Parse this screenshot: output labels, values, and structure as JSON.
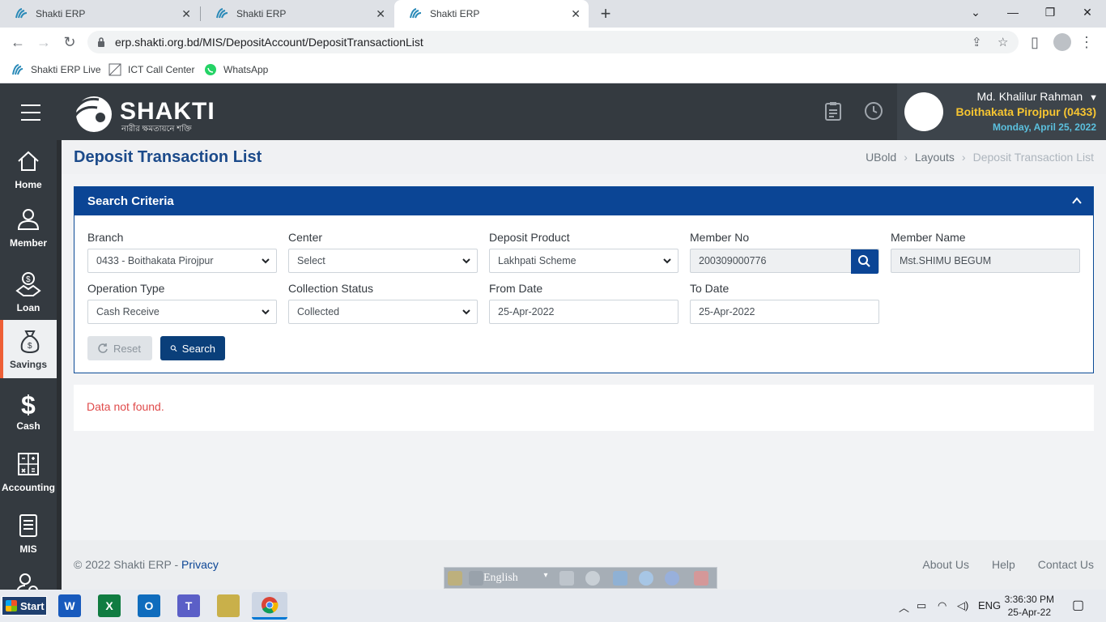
{
  "browser": {
    "tabs": [
      {
        "title": "Shakti ERP"
      },
      {
        "title": "Shakti ERP"
      },
      {
        "title": "Shakti ERP"
      }
    ],
    "url": "erp.shakti.org.bd/MIS/DepositAccount/DepositTransactionList",
    "bookmarks": [
      {
        "label": "Shakti ERP Live"
      },
      {
        "label": "ICT Call Center"
      },
      {
        "label": "WhatsApp"
      }
    ]
  },
  "header": {
    "logo_text": "SHAKTI",
    "logo_subtitle": "নারীর ক্ষমতায়নে শক্তি",
    "user_name": "Md. Khalilur Rahman",
    "branch": "Boithakata Pirojpur (0433)",
    "date": "Monday, April 25, 2022"
  },
  "sidenav": [
    {
      "label": "Home",
      "icon": "home-icon"
    },
    {
      "label": "Member",
      "icon": "user-icon"
    },
    {
      "label": "Loan",
      "icon": "handshake-dollar-icon"
    },
    {
      "label": "Savings",
      "icon": "money-bag-icon",
      "active": true
    },
    {
      "label": "Cash",
      "icon": "dollar-icon"
    },
    {
      "label": "Accounting",
      "icon": "calculator-icon"
    },
    {
      "label": "MIS",
      "icon": "document-icon"
    },
    {
      "label": "",
      "icon": "users-gear-icon"
    }
  ],
  "page": {
    "title": "Deposit Transaction List",
    "breadcrumb": [
      "UBold",
      "Layouts",
      "Deposit Transaction List"
    ]
  },
  "search": {
    "title": "Search Criteria",
    "fields": {
      "branch": {
        "label": "Branch",
        "value": "0433 - Boithakata Pirojpur"
      },
      "center": {
        "label": "Center",
        "value": "Select"
      },
      "deposit_product": {
        "label": "Deposit Product",
        "value": "Lakhpati Scheme"
      },
      "member_no": {
        "label": "Member No",
        "value": "200309000776"
      },
      "member_name": {
        "label": "Member Name",
        "value": "Mst.SHIMU BEGUM"
      },
      "operation_type": {
        "label": "Operation Type",
        "value": "Cash Receive"
      },
      "collection_status": {
        "label": "Collection Status",
        "value": "Collected"
      },
      "from_date": {
        "label": "From Date",
        "value": "25-Apr-2022"
      },
      "to_date": {
        "label": "To Date",
        "value": "25-Apr-2022"
      }
    },
    "reset_label": "Reset",
    "search_label": "Search"
  },
  "result": {
    "message": "Data not found."
  },
  "footer": {
    "copyright": "© 2022 Shakti ERP - ",
    "privacy": "Privacy",
    "links": [
      "About Us",
      "Help",
      "Contact Us"
    ]
  },
  "langbar": {
    "language": "English"
  },
  "taskbar": {
    "start_label": "Start",
    "tray_lang": "ENG",
    "time": "3:36:30 PM",
    "date": "25-Apr-22"
  },
  "colors": {
    "accent": "#0b4595",
    "header_bg": "#343a40",
    "error": "#e04b4b",
    "branch_yellow": "#f7c531"
  }
}
